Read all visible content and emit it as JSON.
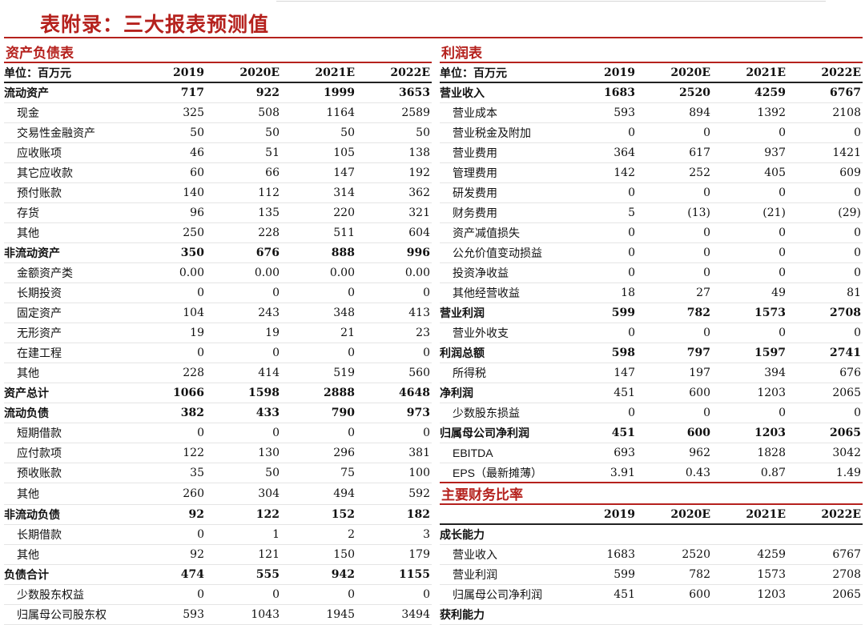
{
  "title": "表附录：三大报表预测值",
  "years": [
    "2019",
    "2020E",
    "2021E",
    "2022E"
  ],
  "balance_sheet": {
    "header": "资产负债表",
    "unit_label": "单位：百万元",
    "rows": [
      {
        "label": "流动资产",
        "values": [
          "717",
          "922",
          "1999",
          "3653"
        ],
        "style": "bold"
      },
      {
        "label": "现金",
        "values": [
          "325",
          "508",
          "1164",
          "2589"
        ],
        "style": "sub"
      },
      {
        "label": "交易性金融资产",
        "values": [
          "50",
          "50",
          "50",
          "50"
        ],
        "style": "sub"
      },
      {
        "label": "应收账项",
        "values": [
          "46",
          "51",
          "105",
          "138"
        ],
        "style": "sub"
      },
      {
        "label": "其它应收款",
        "values": [
          "60",
          "66",
          "147",
          "192"
        ],
        "style": "sub"
      },
      {
        "label": "预付账款",
        "values": [
          "140",
          "112",
          "314",
          "362"
        ],
        "style": "sub"
      },
      {
        "label": "存货",
        "values": [
          "96",
          "135",
          "220",
          "321"
        ],
        "style": "sub"
      },
      {
        "label": "其他",
        "values": [
          "250",
          "228",
          "511",
          "604"
        ],
        "style": "sub"
      },
      {
        "label": "非流动资产",
        "values": [
          "350",
          "676",
          "888",
          "996"
        ],
        "style": "bold"
      },
      {
        "label": "金额资产类",
        "values": [
          "0.00",
          "0.00",
          "0.00",
          "0.00"
        ],
        "style": "sub"
      },
      {
        "label": "长期投资",
        "values": [
          "0",
          "0",
          "0",
          "0"
        ],
        "style": "sub"
      },
      {
        "label": "固定资产",
        "values": [
          "104",
          "243",
          "348",
          "413"
        ],
        "style": "sub"
      },
      {
        "label": "无形资产",
        "values": [
          "19",
          "19",
          "21",
          "23"
        ],
        "style": "sub"
      },
      {
        "label": "在建工程",
        "values": [
          "0",
          "0",
          "0",
          "0"
        ],
        "style": "sub"
      },
      {
        "label": "其他",
        "values": [
          "228",
          "414",
          "519",
          "560"
        ],
        "style": "sub"
      },
      {
        "label": "资产总计",
        "values": [
          "1066",
          "1598",
          "2888",
          "4648"
        ],
        "style": "bold"
      },
      {
        "label": "流动负债",
        "values": [
          "382",
          "433",
          "790",
          "973"
        ],
        "style": "bold"
      },
      {
        "label": "短期借款",
        "values": [
          "0",
          "0",
          "0",
          "0"
        ],
        "style": "sub"
      },
      {
        "label": "应付款项",
        "values": [
          "122",
          "130",
          "296",
          "381"
        ],
        "style": "sub"
      },
      {
        "label": "预收账款",
        "values": [
          "35",
          "50",
          "75",
          "100"
        ],
        "style": "sub"
      },
      {
        "label": "其他",
        "values": [
          "260",
          "304",
          "494",
          "592"
        ],
        "style": "sub tall"
      },
      {
        "label": "非流动负债",
        "values": [
          "92",
          "122",
          "152",
          "182"
        ],
        "style": "bold"
      },
      {
        "label": "长期借款",
        "values": [
          "0",
          "1",
          "2",
          "3"
        ],
        "style": "sub"
      },
      {
        "label": "其他",
        "values": [
          "92",
          "121",
          "150",
          "179"
        ],
        "style": "sub"
      },
      {
        "label": "负债合计",
        "values": [
          "474",
          "555",
          "942",
          "1155"
        ],
        "style": "bold"
      },
      {
        "label": "少数股东权益",
        "values": [
          "0",
          "0",
          "0",
          "0"
        ],
        "style": "sub"
      },
      {
        "label": "归属母公司股东权",
        "values": [
          "593",
          "1043",
          "1945",
          "3494"
        ],
        "style": "sub"
      }
    ]
  },
  "income_statement": {
    "header": "利润表",
    "unit_label": "单位：百万元",
    "rows": [
      {
        "label": "营业收入",
        "values": [
          "1683",
          "2520",
          "4259",
          "6767"
        ],
        "style": "bold"
      },
      {
        "label": "营业成本",
        "values": [
          "593",
          "894",
          "1392",
          "2108"
        ],
        "style": "sub"
      },
      {
        "label": "营业税金及附加",
        "values": [
          "0",
          "0",
          "0",
          "0"
        ],
        "style": "sub"
      },
      {
        "label": "营业费用",
        "values": [
          "364",
          "617",
          "937",
          "1421"
        ],
        "style": "sub"
      },
      {
        "label": "管理费用",
        "values": [
          "142",
          "252",
          "405",
          "609"
        ],
        "style": "sub"
      },
      {
        "label": "研发费用",
        "values": [
          "0",
          "0",
          "0",
          "0"
        ],
        "style": "sub"
      },
      {
        "label": "财务费用",
        "values": [
          "5",
          "(13)",
          "(21)",
          "(29)"
        ],
        "style": "sub"
      },
      {
        "label": "资产减值损失",
        "values": [
          "0",
          "0",
          "0",
          "0"
        ],
        "style": "sub"
      },
      {
        "label": "公允价值变动损益",
        "values": [
          "0",
          "0",
          "0",
          "0"
        ],
        "style": "sub"
      },
      {
        "label": "投资净收益",
        "values": [
          "0",
          "0",
          "0",
          "0"
        ],
        "style": "sub"
      },
      {
        "label": "其他经营收益",
        "values": [
          "18",
          "27",
          "49",
          "81"
        ],
        "style": "sub"
      },
      {
        "label": "营业利润",
        "values": [
          "599",
          "782",
          "1573",
          "2708"
        ],
        "style": "bold"
      },
      {
        "label": "营业外收支",
        "values": [
          "0",
          "0",
          "0",
          "0"
        ],
        "style": "sub"
      },
      {
        "label": "利润总额",
        "values": [
          "598",
          "797",
          "1597",
          "2741"
        ],
        "style": "bold"
      },
      {
        "label": "所得税",
        "values": [
          "147",
          "197",
          "394",
          "676"
        ],
        "style": "sub"
      },
      {
        "label": "净利润",
        "values": [
          "451",
          "600",
          "1203",
          "2065"
        ],
        "style": "boldlabel"
      },
      {
        "label": "少数股东损益",
        "values": [
          "0",
          "0",
          "0",
          "0"
        ],
        "style": "sub"
      },
      {
        "label": "归属母公司净利润",
        "values": [
          "451",
          "600",
          "1203",
          "2065"
        ],
        "style": "bold"
      },
      {
        "label": "EBITDA",
        "values": [
          "693",
          "962",
          "1828",
          "3042"
        ],
        "style": "sub en"
      },
      {
        "label": "EPS（最新摊薄）",
        "values": [
          "3.91",
          "0.43",
          "0.87",
          "1.49"
        ],
        "style": "sub en last"
      }
    ]
  },
  "ratios": {
    "header": "主要财务比率",
    "rows": [
      {
        "label": "成长能力",
        "values": [
          "",
          "",
          "",
          ""
        ],
        "style": "boldlabel"
      },
      {
        "label": "营业收入",
        "values": [
          "1683",
          "2520",
          "4259",
          "6767"
        ],
        "style": "sub"
      },
      {
        "label": "营业利润",
        "values": [
          "599",
          "782",
          "1573",
          "2708"
        ],
        "style": "sub"
      },
      {
        "label": "归属母公司净利润",
        "values": [
          "451",
          "600",
          "1203",
          "2065"
        ],
        "style": "sub"
      },
      {
        "label": "获利能力",
        "values": [
          "",
          "",
          "",
          ""
        ],
        "style": "boldlabel"
      }
    ]
  }
}
